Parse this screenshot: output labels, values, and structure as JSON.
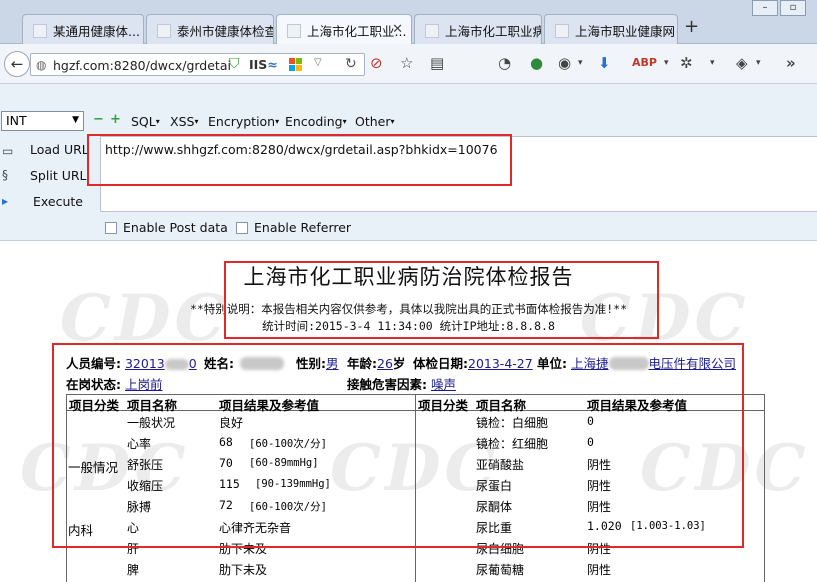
{
  "browser": {
    "tabs": [
      {
        "label": "某通用健康体...",
        "active": false
      },
      {
        "label": "泰州市健康体检查...",
        "active": false
      },
      {
        "label": "上海市化工职业...",
        "active": true
      },
      {
        "label": "上海市化工职业病...",
        "active": false
      },
      {
        "label": "上海市职业健康网",
        "active": false
      }
    ],
    "new_tab_symbol": "+",
    "url_display": "hgzf.com:8280/dwcx/grdetai",
    "iis_label": "IIS"
  },
  "hackbar": {
    "encoding_select": "INT",
    "menus": [
      "SQL",
      "XSS",
      "Encryption",
      "Encoding",
      "Other"
    ],
    "actions": {
      "load": "Load URL",
      "split": "Split URL",
      "execute": "Execute"
    },
    "url_value": "http://www.shhgzf.com:8280/dwcx/grdetail.asp?bhkidx=10076",
    "enable_post": "Enable Post data",
    "enable_referrer": "Enable Referrer"
  },
  "report": {
    "title": "上海市化工职业病防治院体检报告",
    "note": "**特别说明：本报告相关内容仅供参考，具体以我院出具的正式书面体检报告为准!**",
    "stats": "统计时间:2015-3-4 11:34:00  统计IP地址:8.8.8.8",
    "watermark": "CDC",
    "person": {
      "id_label": "人员编号:",
      "id_value": "32013",
      "id_value_tail": "0",
      "name_label": "姓名:",
      "sex_label": "性别:",
      "sex_value": "男",
      "age_label": "年龄:",
      "age_value": "26",
      "age_unit": "岁",
      "date_label": "体检日期:",
      "date_value": "2013-4-27",
      "unit_label": "单位:",
      "unit_value_head": "上海捷",
      "unit_value_tail": "电压件有限公司",
      "status_label": "在岗状态:",
      "status_value": "上岗前",
      "hazard_label": "接触危害因素:",
      "hazard_value": "噪声"
    },
    "table_headers": [
      "项目分类",
      "项目名称",
      "项目结果及参考值"
    ],
    "left_categories": {
      "general": "一般情况",
      "internal": "内科"
    },
    "left_rows": [
      {
        "name": "一般状况",
        "result": "良好",
        "ref": ""
      },
      {
        "name": "心率",
        "result": "68",
        "ref": "[60-100次/分]"
      },
      {
        "name": "舒张压",
        "result": "70",
        "ref": "[60-89mmHg]"
      },
      {
        "name": "收缩压",
        "result": "115",
        "ref": "[90-139mmHg]"
      },
      {
        "name": "脉搏",
        "result": "72",
        "ref": "[60-100次/分]"
      },
      {
        "name": "心",
        "result": "心律齐无杂音",
        "ref": ""
      },
      {
        "name": "肝",
        "result": "肋下未及",
        "ref": ""
      },
      {
        "name": "脾",
        "result": "肋下未及",
        "ref": ""
      }
    ],
    "right_rows": [
      {
        "name": "镜检：白细胞",
        "result": "0",
        "ref": ""
      },
      {
        "name": "镜检：红细胞",
        "result": "0",
        "ref": ""
      },
      {
        "name": "亚硝酸盐",
        "result": "阴性",
        "ref": ""
      },
      {
        "name": "尿蛋白",
        "result": "阴性",
        "ref": ""
      },
      {
        "name": "尿酮体",
        "result": "阴性",
        "ref": ""
      },
      {
        "name": "尿比重",
        "result": "1.020",
        "ref": "[1.003-1.03]"
      },
      {
        "name": "尿白细胞",
        "result": "阴性",
        "ref": ""
      },
      {
        "name": "尿葡萄糖",
        "result": "阴性",
        "ref": ""
      }
    ]
  },
  "colors": {
    "annotation_red": "#e02a2a",
    "link_blue": "#1b1b8f",
    "hackbar_bg": "#e8f0f8"
  }
}
